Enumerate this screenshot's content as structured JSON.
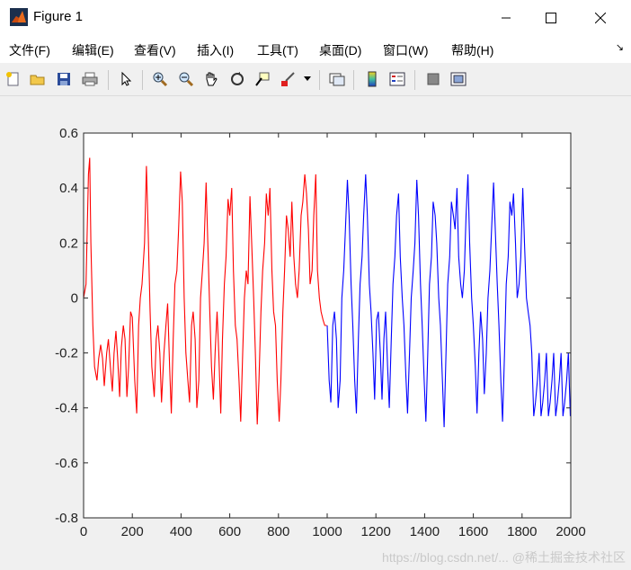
{
  "window": {
    "title": "Figure 1"
  },
  "menu": {
    "items": [
      {
        "label": "文件(F)"
      },
      {
        "label": "编辑(E)"
      },
      {
        "label": "查看(V)"
      },
      {
        "label": "插入(I)"
      },
      {
        "label": "工具(T)"
      },
      {
        "label": "桌面(D)"
      },
      {
        "label": "窗口(W)"
      },
      {
        "label": "帮助(H)"
      }
    ]
  },
  "toolbar": {
    "icons": [
      "new-figure-icon",
      "open-file-icon",
      "save-icon",
      "print-icon",
      "pointer-icon",
      "zoom-in-icon",
      "zoom-out-icon",
      "pan-hand-icon",
      "rotate-3d-icon",
      "data-cursor-icon",
      "brush-icon",
      "link-plot-icon",
      "colorbar-icon",
      "legend-icon",
      "hide-plot-tools-icon",
      "show-plot-tools-icon"
    ]
  },
  "chart_data": {
    "type": "line",
    "xlim": [
      0,
      2000
    ],
    "ylim": [
      -0.8,
      0.6
    ],
    "xticks": [
      0,
      200,
      400,
      600,
      800,
      1000,
      1200,
      1400,
      1600,
      1800,
      2000
    ],
    "yticks": [
      -0.8,
      -0.6,
      -0.4,
      -0.2,
      0,
      0.2,
      0.4,
      0.6
    ],
    "xtick_labels": [
      "0",
      "200",
      "400",
      "600",
      "800",
      "1000",
      "1200",
      "1400",
      "1600",
      "1800",
      "2000"
    ],
    "ytick_labels": [
      "-0.8",
      "-0.6",
      "-0.4",
      "-0.2",
      "0",
      "0.2",
      "0.4",
      "0.6"
    ],
    "grid": false,
    "series": [
      {
        "color": "#ff0000",
        "x": [
          0,
          10,
          20,
          25,
          30,
          38,
          45,
          55,
          62,
          70,
          78,
          85,
          95,
          102,
          110,
          118,
          125,
          133,
          140,
          148,
          155,
          163,
          170,
          178,
          185,
          193,
          200,
          210,
          218,
          226,
          233,
          240,
          250,
          258,
          265,
          273,
          280,
          290,
          298,
          305,
          313,
          320,
          330,
          338,
          345,
          353,
          360,
          368,
          375,
          383,
          390,
          398,
          405,
          413,
          420,
          428,
          435,
          443,
          450,
          458,
          465,
          473,
          480,
          488,
          495,
          503,
          510,
          518,
          525,
          533,
          540,
          548,
          555,
          563,
          570,
          578,
          585,
          593,
          600,
          608,
          615,
          623,
          630,
          638,
          645,
          653,
          660,
          668,
          675,
          683,
          690,
          698,
          705,
          713,
          720,
          728,
          735,
          743,
          750,
          758,
          765,
          773,
          780,
          788,
          795,
          803,
          810,
          818,
          825,
          833,
          840,
          848,
          855,
          863,
          870,
          878,
          885,
          893,
          900,
          908,
          915,
          923,
          930,
          938,
          945,
          953,
          960,
          968,
          975,
          983,
          990,
          998
        ],
        "y": [
          0.0,
          0.05,
          0.45,
          0.51,
          0.2,
          -0.1,
          -0.25,
          -0.3,
          -0.22,
          -0.17,
          -0.22,
          -0.32,
          -0.2,
          -0.15,
          -0.25,
          -0.34,
          -0.2,
          -0.12,
          -0.22,
          -0.36,
          -0.18,
          -0.1,
          -0.15,
          -0.36,
          -0.25,
          -0.05,
          -0.07,
          -0.3,
          -0.42,
          -0.1,
          0.0,
          0.05,
          0.2,
          0.48,
          0.25,
          -0.05,
          -0.25,
          -0.36,
          -0.15,
          -0.1,
          -0.2,
          -0.38,
          -0.2,
          -0.1,
          -0.02,
          -0.25,
          -0.42,
          -0.15,
          0.05,
          0.1,
          0.25,
          0.46,
          0.35,
          0.0,
          -0.2,
          -0.3,
          -0.38,
          -0.1,
          -0.05,
          -0.15,
          -0.4,
          -0.3,
          0.0,
          0.1,
          0.2,
          0.42,
          0.2,
          -0.05,
          -0.25,
          -0.37,
          -0.2,
          -0.05,
          -0.2,
          -0.42,
          -0.15,
          0.05,
          0.15,
          0.36,
          0.3,
          0.4,
          0.1,
          -0.1,
          -0.15,
          -0.3,
          -0.45,
          -0.2,
          0.0,
          0.1,
          0.05,
          0.37,
          0.2,
          0.0,
          -0.2,
          -0.46,
          -0.3,
          -0.05,
          0.1,
          0.2,
          0.38,
          0.3,
          0.4,
          0.1,
          -0.05,
          -0.1,
          -0.3,
          -0.45,
          -0.3,
          -0.05,
          0.1,
          0.3,
          0.25,
          0.15,
          0.35,
          0.15,
          0.05,
          0.0,
          0.1,
          0.3,
          0.35,
          0.45,
          0.38,
          0.25,
          0.05,
          0.1,
          0.3,
          0.45,
          0.1,
          0.0,
          -0.05,
          -0.08,
          -0.1,
          -0.1
        ]
      },
      {
        "color": "#0000ff",
        "x": [
          1000,
          1008,
          1015,
          1023,
          1030,
          1038,
          1045,
          1053,
          1060,
          1068,
          1075,
          1083,
          1090,
          1098,
          1105,
          1113,
          1120,
          1128,
          1135,
          1143,
          1150,
          1158,
          1165,
          1173,
          1180,
          1188,
          1195,
          1203,
          1210,
          1218,
          1225,
          1233,
          1240,
          1248,
          1255,
          1263,
          1270,
          1278,
          1285,
          1293,
          1300,
          1308,
          1315,
          1323,
          1330,
          1338,
          1345,
          1353,
          1360,
          1368,
          1375,
          1383,
          1390,
          1398,
          1405,
          1413,
          1420,
          1428,
          1435,
          1443,
          1450,
          1458,
          1465,
          1473,
          1480,
          1488,
          1495,
          1503,
          1510,
          1518,
          1525,
          1533,
          1540,
          1548,
          1555,
          1563,
          1570,
          1578,
          1585,
          1593,
          1600,
          1608,
          1615,
          1623,
          1630,
          1638,
          1645,
          1653,
          1660,
          1668,
          1675,
          1683,
          1690,
          1698,
          1705,
          1713,
          1720,
          1728,
          1735,
          1743,
          1750,
          1758,
          1765,
          1773,
          1780,
          1788,
          1795,
          1803,
          1810,
          1818,
          1825,
          1833,
          1840,
          1848,
          1855,
          1863,
          1870,
          1878,
          1885,
          1893,
          1900,
          1908,
          1915,
          1923,
          1930,
          1938,
          1945,
          1953,
          1960,
          1968,
          1975,
          1983,
          1990,
          1998
        ],
        "y": [
          -0.1,
          -0.3,
          -0.38,
          -0.1,
          -0.05,
          -0.15,
          -0.4,
          -0.3,
          0.0,
          0.1,
          0.25,
          0.43,
          0.3,
          0.05,
          -0.1,
          -0.3,
          -0.42,
          -0.15,
          0.05,
          0.15,
          0.3,
          0.45,
          0.3,
          0.05,
          -0.05,
          -0.2,
          -0.37,
          -0.08,
          -0.05,
          -0.2,
          -0.37,
          -0.15,
          -0.05,
          -0.25,
          -0.4,
          -0.15,
          0.05,
          0.15,
          0.3,
          0.38,
          0.15,
          0.0,
          -0.1,
          -0.28,
          -0.42,
          -0.2,
          0.0,
          0.1,
          0.2,
          0.43,
          0.3,
          0.05,
          -0.1,
          -0.3,
          -0.45,
          -0.2,
          0.05,
          0.15,
          0.35,
          0.3,
          0.2,
          0.0,
          -0.1,
          -0.3,
          -0.47,
          -0.2,
          0.05,
          0.15,
          0.35,
          0.3,
          0.25,
          0.4,
          0.15,
          0.05,
          0.0,
          0.1,
          0.3,
          0.45,
          0.2,
          0.0,
          -0.1,
          -0.25,
          -0.42,
          -0.2,
          -0.05,
          -0.15,
          -0.35,
          -0.2,
          0.0,
          0.1,
          0.25,
          0.42,
          0.25,
          0.05,
          -0.1,
          -0.3,
          -0.45,
          -0.2,
          0.05,
          0.15,
          0.35,
          0.3,
          0.38,
          0.2,
          0.0,
          0.05,
          0.15,
          0.4,
          0.2,
          0.0,
          -0.05,
          -0.1,
          -0.2,
          -0.43,
          -0.38,
          -0.3,
          -0.2,
          -0.43,
          -0.38,
          -0.3,
          -0.2,
          -0.43,
          -0.38,
          -0.3,
          -0.2,
          -0.43,
          -0.38,
          -0.3,
          -0.2,
          -0.43,
          -0.38,
          -0.3,
          -0.2,
          -0.43
        ]
      }
    ]
  },
  "watermark": "https://blog.csdn.net/... @稀土掘金技术社区"
}
